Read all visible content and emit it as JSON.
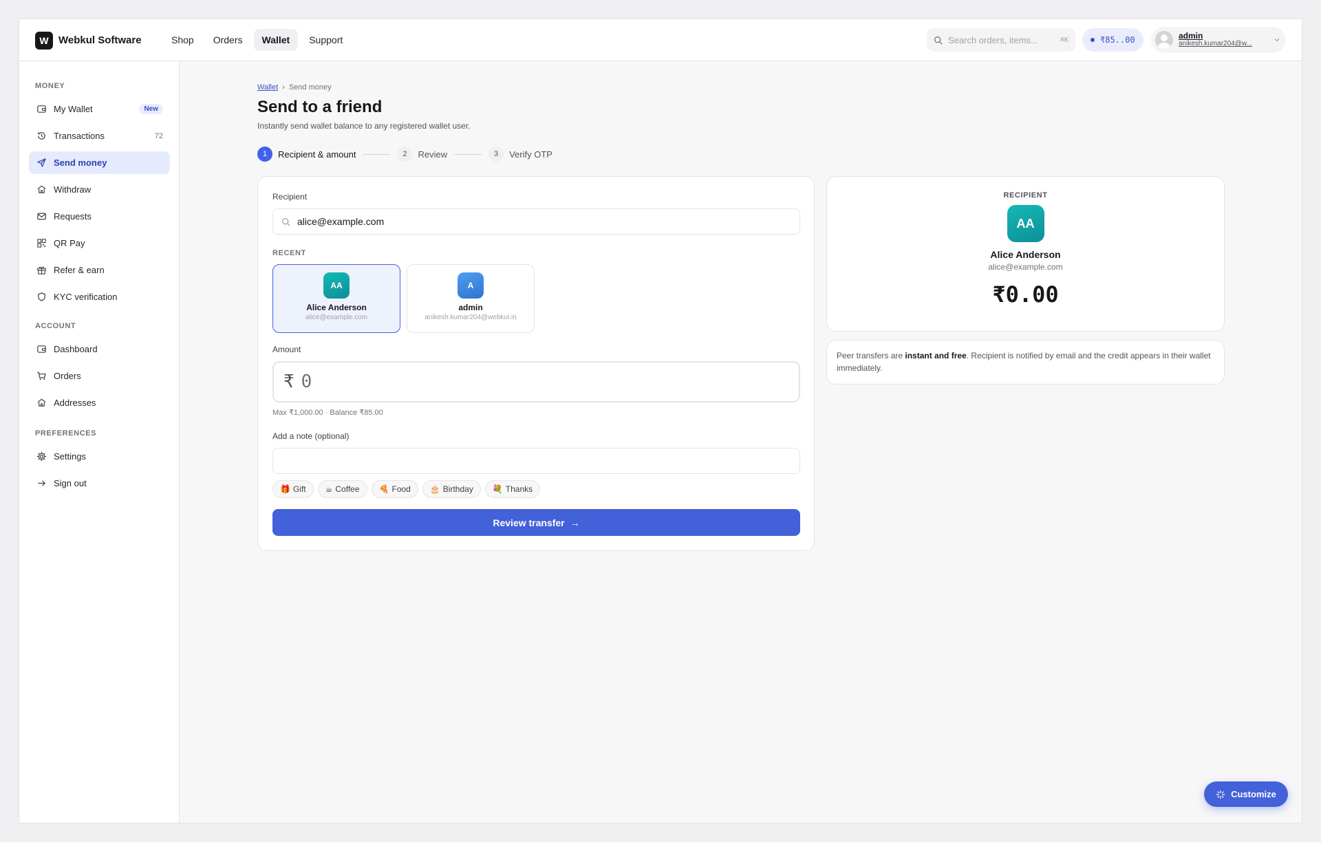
{
  "header": {
    "logo_letter": "W",
    "brand": "Webkul Software",
    "nav": [
      "Shop",
      "Orders",
      "Wallet",
      "Support"
    ],
    "search_placeholder": "Search orders, items...",
    "search_shortcut": "⌘K",
    "balance": "₹85..00",
    "user_name": "admin",
    "user_email": "anikesh.kumar204@w..."
  },
  "sidebar": {
    "money_label": "MONEY",
    "money_items": [
      {
        "label": "My Wallet",
        "badge": "New",
        "icon": "wallet-icon"
      },
      {
        "label": "Transactions",
        "count": "72",
        "icon": "history-icon"
      },
      {
        "label": "Send money",
        "icon": "send-icon",
        "active": true
      },
      {
        "label": "Withdraw",
        "icon": "bank-icon"
      },
      {
        "label": "Requests",
        "icon": "mail-icon"
      },
      {
        "label": "QR Pay",
        "icon": "qr-icon"
      },
      {
        "label": "Refer & earn",
        "icon": "gift-icon"
      },
      {
        "label": "KYC verification",
        "icon": "shield-icon"
      }
    ],
    "account_label": "ACCOUNT",
    "account_items": [
      {
        "label": "Dashboard",
        "icon": "dashboard-icon"
      },
      {
        "label": "Orders",
        "icon": "cart-icon"
      },
      {
        "label": "Addresses",
        "icon": "home-icon"
      }
    ],
    "prefs_label": "PREFERENCES",
    "prefs_items": [
      {
        "label": "Settings",
        "icon": "gear-icon"
      },
      {
        "label": "Sign out",
        "icon": "arrow-right-icon"
      }
    ]
  },
  "main": {
    "breadcrumb_link": "Wallet",
    "breadcrumb_sep": "›",
    "breadcrumb_current": "Send money",
    "title": "Send to a friend",
    "subtitle": "Instantly send wallet balance to any registered wallet user.",
    "steps": [
      {
        "num": "1",
        "label": "Recipient & amount",
        "active": true
      },
      {
        "num": "2",
        "label": "Review"
      },
      {
        "num": "3",
        "label": "Verify OTP"
      }
    ]
  },
  "form": {
    "recipient_label": "Recipient",
    "recipient_value": "alice@example.com",
    "recent_label": "RECENT",
    "recent": [
      {
        "initials": "AA",
        "name": "Alice Anderson",
        "email": "alice@example.com",
        "selected": true
      },
      {
        "initials": "A",
        "name": "admin",
        "email": "anikesh.kumar204@webkul.in"
      }
    ],
    "amount_label": "Amount",
    "currency_symbol": "₹",
    "amount_value": "0",
    "amount_hint": "Max ₹1,000.00 · Balance ₹85.00",
    "note_label": "Add a note (optional)",
    "note_value": "",
    "chips": [
      {
        "emoji": "🎁",
        "label": "Gift"
      },
      {
        "emoji": "☕",
        "label": "Coffee"
      },
      {
        "emoji": "🍕",
        "label": "Food"
      },
      {
        "emoji": "🎂",
        "label": "Birthday"
      },
      {
        "emoji": "💐",
        "label": "Thanks"
      }
    ],
    "submit_label": "Review transfer",
    "submit_arrow": "→"
  },
  "preview": {
    "caption": "RECIPIENT",
    "initials": "AA",
    "name": "Alice Anderson",
    "email": "alice@example.com",
    "amount": "₹0.00"
  },
  "info": {
    "text_before": "Peer transfers are ",
    "text_bold": "instant and free",
    "text_after": ". Recipient is notified by email and the credit appears in their wallet immediately."
  },
  "customize_label": "Customize",
  "colors": {
    "accent": "#4361d8",
    "accent_soft": "#e5ebfd",
    "teal_avatar": "#0e8f99",
    "blue_avatar": "#2f74d0"
  }
}
